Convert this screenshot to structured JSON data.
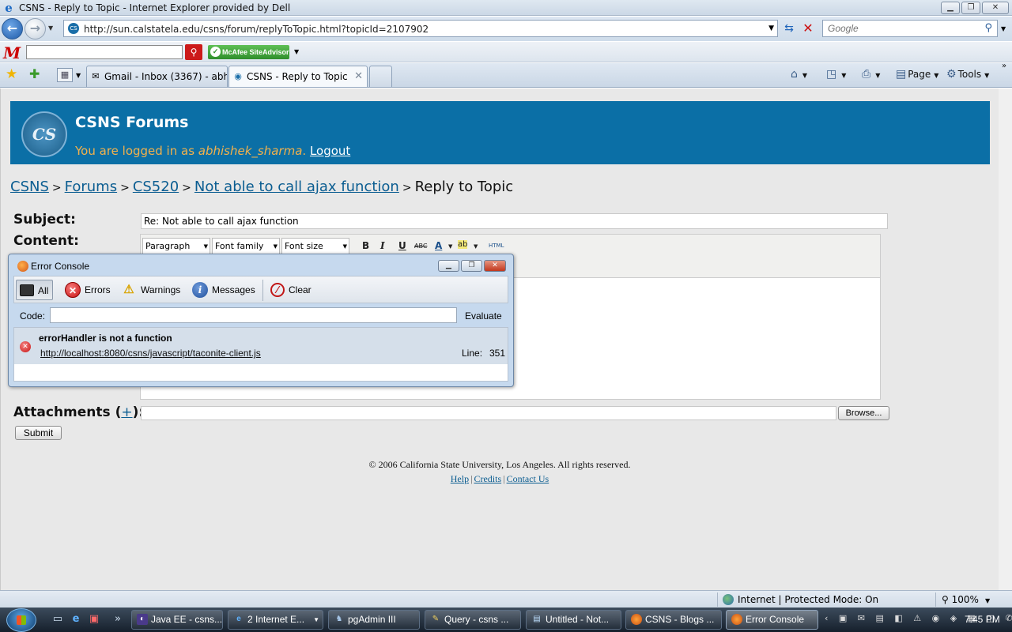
{
  "window": {
    "title": "CSNS - Reply to Topic - Internet Explorer provided by Dell",
    "minimize_glyph": "▁",
    "maximize_glyph": "❐",
    "close_glyph": "✕"
  },
  "address_bar": {
    "url": "http://sun.calstatela.edu/csns/forum/replyToTopic.html?topicId=2107902",
    "search_placeholder": "Google",
    "back_icon": "arrow-left-icon",
    "forward_icon": "arrow-right-icon"
  },
  "mcafee_toolbar": {
    "logo": "M",
    "siteadvisor_label": "McAfee SiteAdvisor"
  },
  "tabs": [
    {
      "label": "Gmail - Inbox (3367) - abhi...",
      "active": false
    },
    {
      "label": "CSNS - Reply to Topic",
      "active": true
    }
  ],
  "command_bar": {
    "page_label": "Page",
    "tools_label": "Tools"
  },
  "banner": {
    "logo_text": "CS",
    "site_title": "CSNS Forums",
    "logged_in_prefix": "You are logged in as ",
    "username": "abhishek_sharma",
    "period": ".",
    "logout_label": "Logout",
    "background_color": "#0b6fa6"
  },
  "breadcrumb": [
    {
      "label": "CSNS",
      "link": true
    },
    {
      "label": "Forums",
      "link": true
    },
    {
      "label": "CS520",
      "link": true
    },
    {
      "label": "Not able to call ajax function",
      "link": true
    },
    {
      "label": "Reply to Topic",
      "link": false
    }
  ],
  "breadcrumb_separator": ">",
  "form": {
    "subject_label": "Subject:",
    "subject_value": "Re: Not able to call ajax function",
    "content_label": "Content:",
    "editor": {
      "format_select": "Paragraph",
      "font_family_select": "Font family",
      "font_size_select": "Font size",
      "bold": "B",
      "italic": "I",
      "underline": "U",
      "strikethrough": "ABC",
      "text_color": "A",
      "highlight": "ab",
      "html": "HTML"
    },
    "attachments_label_prefix": "Attachments (",
    "attachments_plus": "+",
    "attachments_label_suffix": "):",
    "browse_label": "Browse...",
    "submit_label": "Submit"
  },
  "footer": {
    "copyright": "© 2006 California State University, Los Angeles. All rights reserved.",
    "links": [
      "Help",
      "Credits",
      "Contact Us"
    ],
    "separator": "|"
  },
  "error_console": {
    "title": "Error Console",
    "toolbar": {
      "all": "All",
      "errors": "Errors",
      "warnings": "Warnings",
      "messages": "Messages",
      "clear": "Clear"
    },
    "code_label": "Code:",
    "evaluate_label": "Evaluate",
    "entries": [
      {
        "message": "errorHandler is not a function",
        "source": "http://localhost:8080/csns/javascript/taconite-client.js",
        "line_label": "Line:",
        "line": "351"
      }
    ]
  },
  "status_bar": {
    "zone_text": "Internet | Protected Mode: On",
    "zoom": "100%"
  },
  "taskbar": {
    "tasks": [
      {
        "label": "Java EE - csns...",
        "icon": "eclipse-icon"
      },
      {
        "label": "2 Internet E...",
        "icon": "ie-icon"
      },
      {
        "label": "pgAdmin III",
        "icon": "elephant-icon"
      },
      {
        "label": "Query - csns ...",
        "icon": "query-icon"
      },
      {
        "label": "Untitled - Not...",
        "icon": "notepad-icon"
      },
      {
        "label": "CSNS - Blogs ...",
        "icon": "firefox-icon"
      },
      {
        "label": "Error Console",
        "icon": "firefox-icon"
      }
    ],
    "clock": "7:45 PM"
  }
}
